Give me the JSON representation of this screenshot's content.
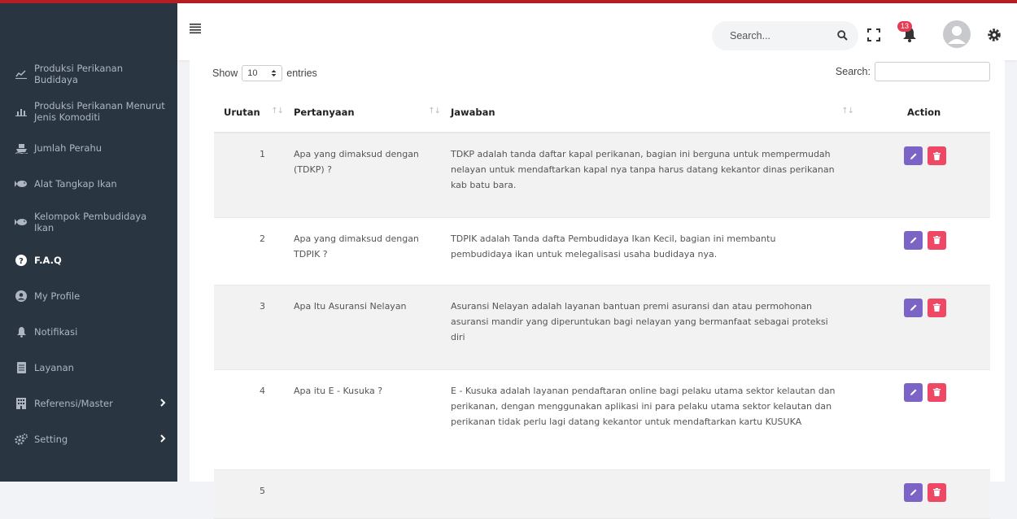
{
  "topbar": {
    "search_placeholder": "Search...",
    "notification_count": "13"
  },
  "sidebar": {
    "items": [
      {
        "label": "Produksi Perikanan Budidaya",
        "icon": "chart-line-icon"
      },
      {
        "label": "Produksi Perikanan Menurut Jenis Komoditi",
        "icon": "chart-bar-icon"
      },
      {
        "label": "Jumlah Perahu",
        "icon": "ship-icon"
      },
      {
        "label": "Alat Tangkap Ikan",
        "icon": "fish-icon"
      },
      {
        "label": "Kelompok Pembudidaya Ikan",
        "icon": "fish-icon"
      },
      {
        "label": "F.A.Q",
        "icon": "question-circle-icon"
      },
      {
        "label": "My Profile",
        "icon": "user-circle-icon"
      },
      {
        "label": "Notifikasi",
        "icon": "bell-icon"
      },
      {
        "label": "Layanan",
        "icon": "document-icon"
      },
      {
        "label": "Referensi/Master",
        "icon": "building-icon"
      },
      {
        "label": "Setting",
        "icon": "cogs-icon"
      }
    ]
  },
  "datatable": {
    "show_label": "Show",
    "entries_value": "10",
    "entries_label": "entries",
    "search_label": "Search:",
    "columns": [
      "Urutan",
      "Pertanyaan",
      "Jawaban",
      "Action"
    ],
    "rows": [
      {
        "no": "1",
        "q": "Apa yang dimaksud dengan (TDKP) ?",
        "a": "TDKP adalah tanda daftar kapal perikanan, bagian ini berguna untuk mempermudah nelayan untuk mendaftarkan kapal nya tanpa harus datang kekantor dinas perikanan kab batu bara."
      },
      {
        "no": "2",
        "q": "Apa yang dimaksud dengan TDPIK ?",
        "a": "TDPIK adalah Tanda dafta Pembudidaya Ikan Kecil, bagian ini membantu pembudidaya ikan untuk melegalisasi usaha budidaya nya."
      },
      {
        "no": "3",
        "q": "Apa Itu Asuransi Nelayan",
        "a": "Asuransi Nelayan adalah layanan bantuan premi asuransi dan atau  permohonan asuransi mandir yang diperuntukan bagi nelayan yang bermanfaat sebagai proteksi diri"
      },
      {
        "no": "4",
        "q": "Apa itu E - Kusuka ?",
        "a": "E - Kusuka adalah layanan pendaftaran online bagi pelaku utama sektor kelautan dan perikanan, dengan menggunakan aplikasi ini para pelaku utama sektor kelautan dan perikanan tidak perlu lagi datang kekantor untuk mendaftarkan kartu KUSUKA"
      },
      {
        "no": "5",
        "q": "",
        "a": ""
      }
    ]
  },
  "colors": {
    "sidebar_bg": "#2a3542",
    "edit_button": "#7b64c6",
    "delete_button": "#ef4865",
    "top_border": "#b31d23",
    "badge": "#e63b55"
  }
}
